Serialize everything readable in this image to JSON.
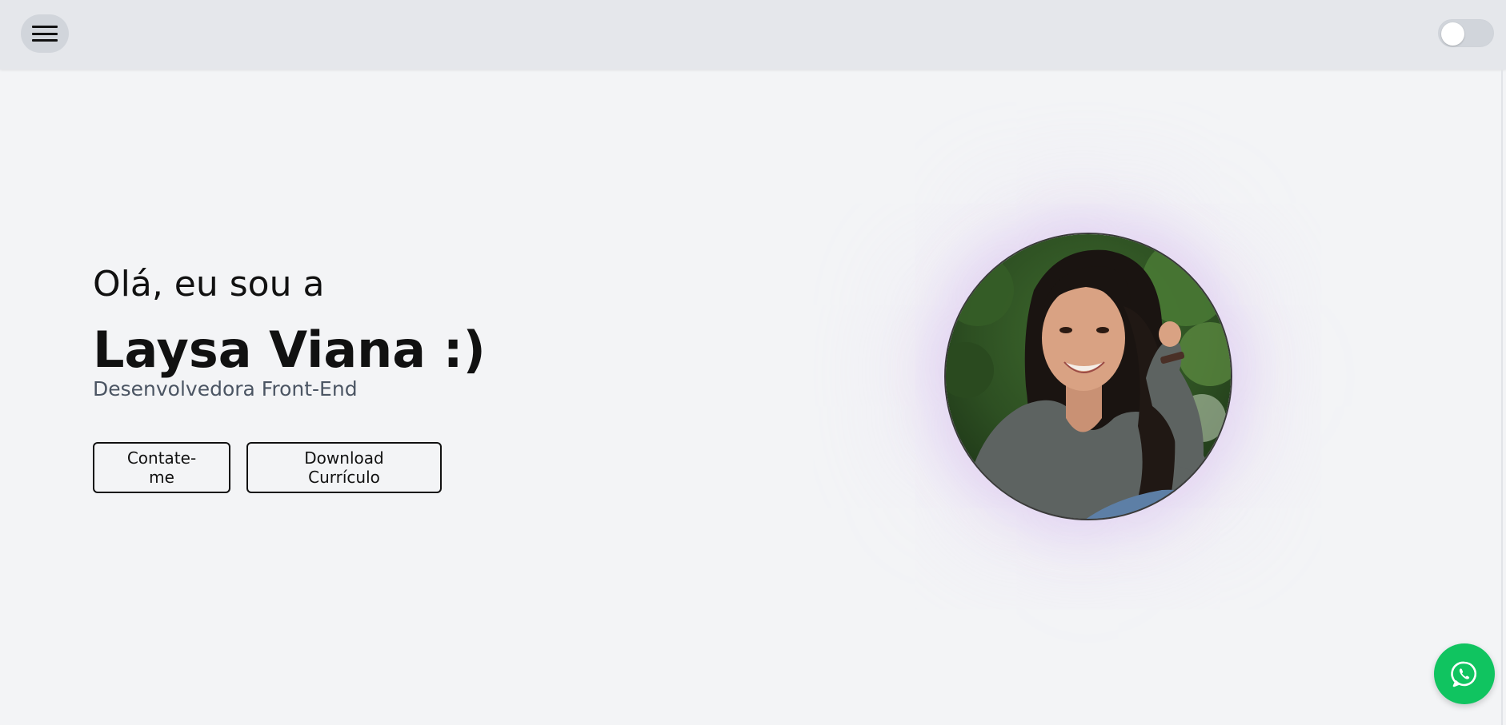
{
  "header": {
    "menu_icon": "hamburger-icon",
    "theme_toggle": {
      "state": "off"
    }
  },
  "hero": {
    "greeting": "Olá, eu sou a",
    "name": "Laysa Viana :)",
    "role": "Desenvolvedora Front-End",
    "buttons": {
      "contact_label": "Contate-me",
      "download_label": "Download Currículo"
    }
  },
  "profile_photo": {
    "alt": "Laysa Viana"
  },
  "floating": {
    "whatsapp_icon": "whatsapp-icon"
  },
  "colors": {
    "header_bg": "#e5e7eb",
    "page_bg": "#f3f4f6",
    "whatsapp_green": "#10c460",
    "glow": "#c8a0eb"
  }
}
